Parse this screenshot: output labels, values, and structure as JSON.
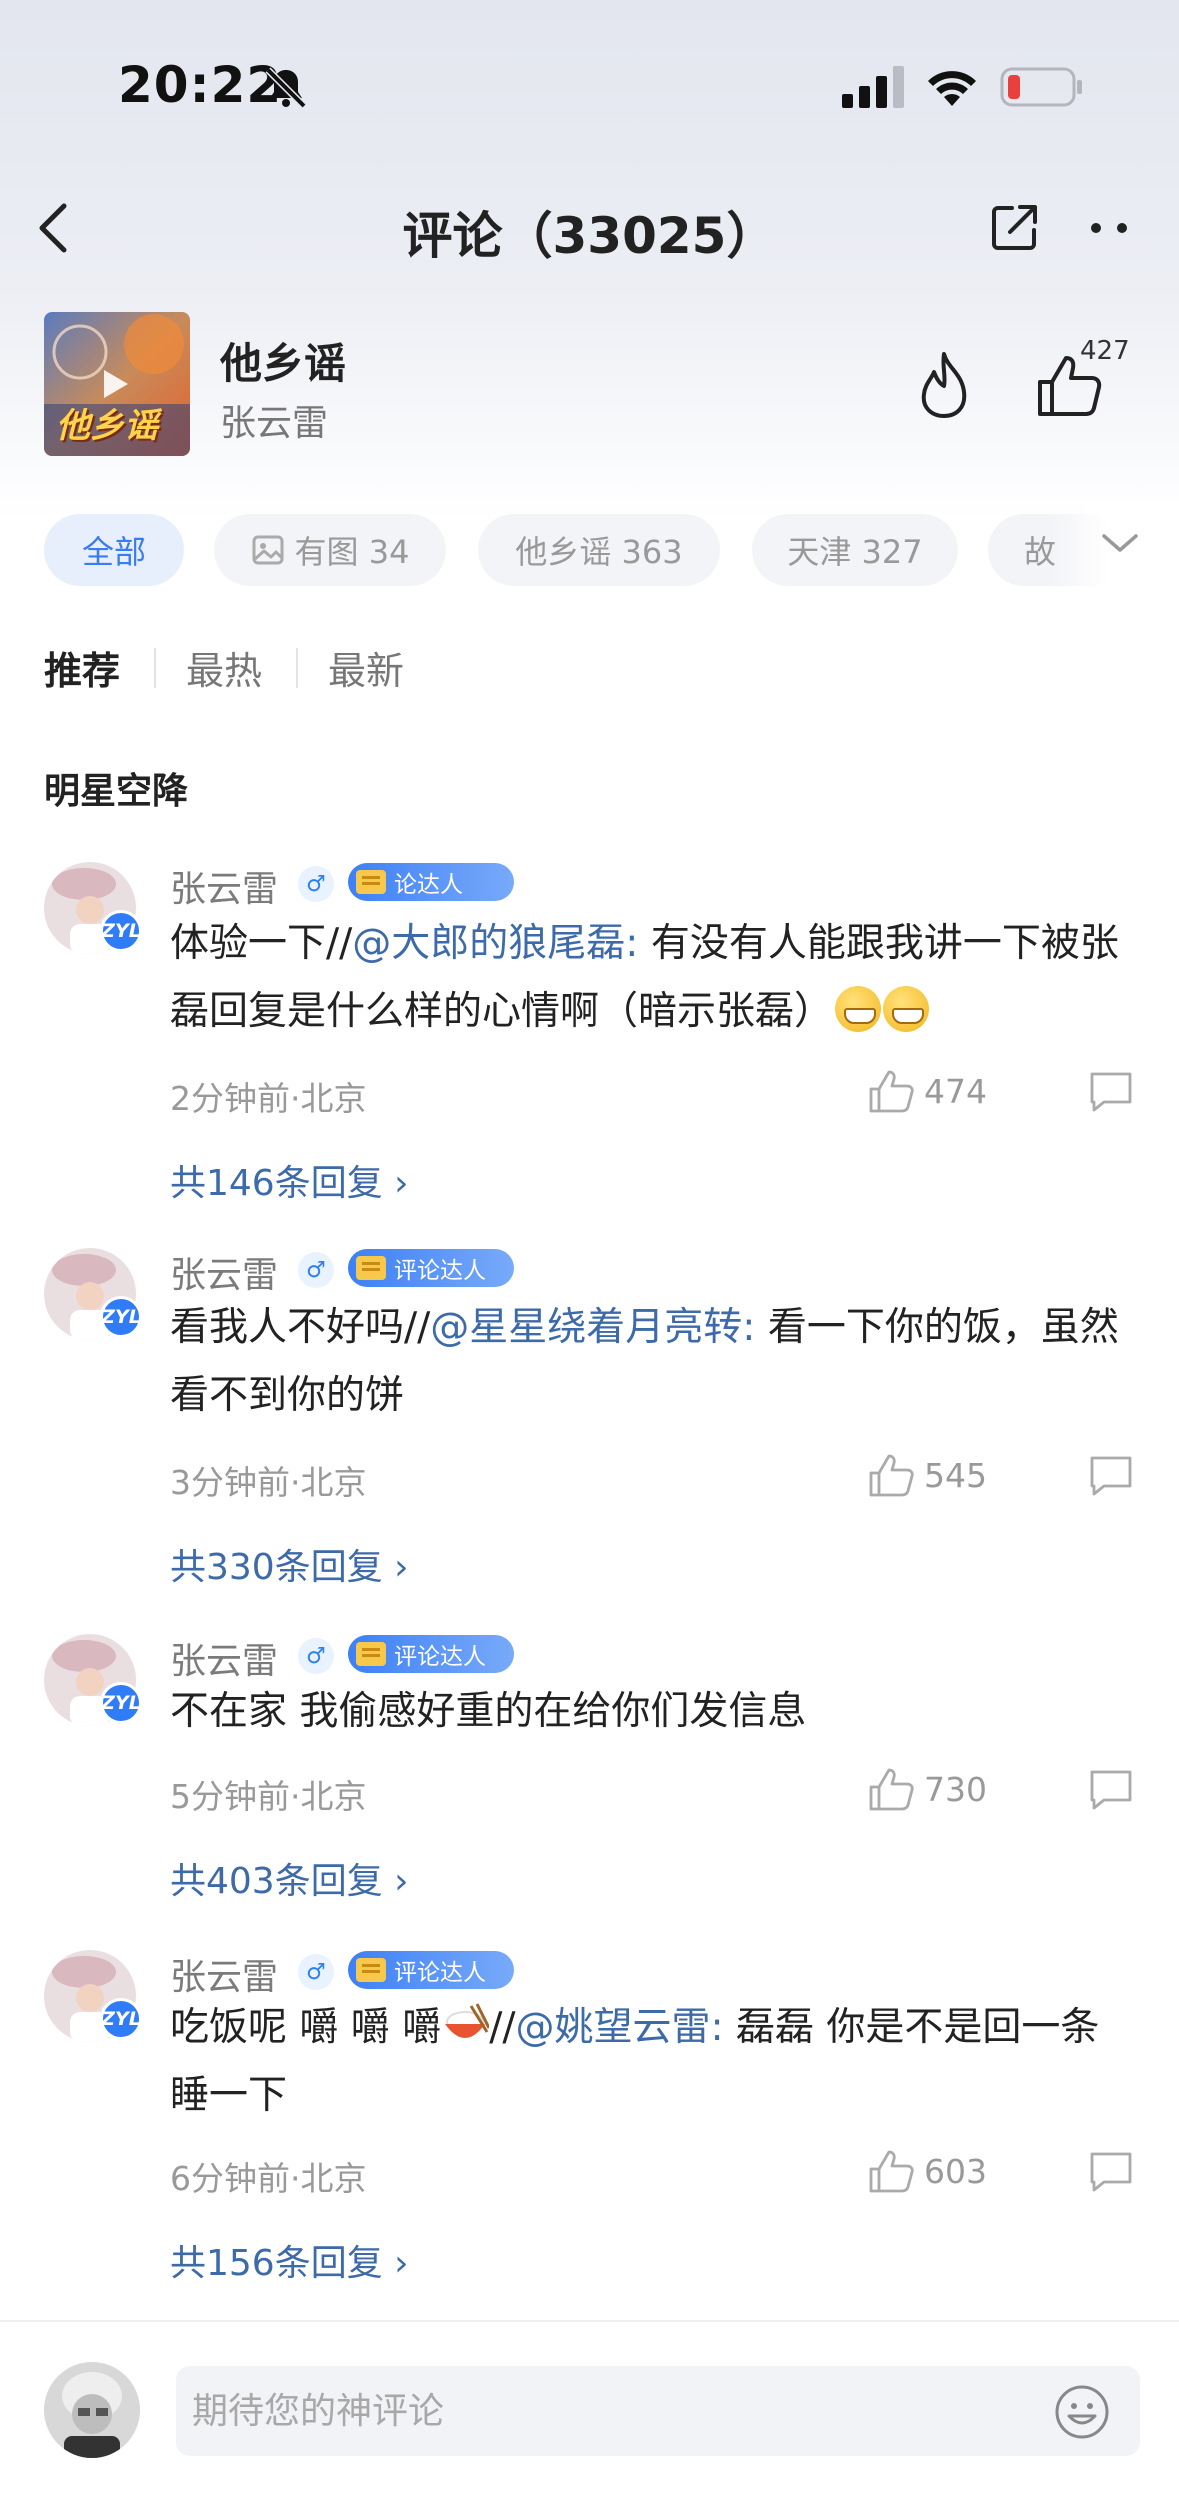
{
  "status_bar": {
    "time": "20:22"
  },
  "nav": {
    "title": "评论（33025）"
  },
  "song": {
    "title": "他乡谣",
    "artist": "张云雷",
    "cover_text": "他乡谣",
    "like_count": "427"
  },
  "chips": [
    {
      "label": "全部"
    },
    {
      "label": "有图 34"
    },
    {
      "label": "他乡谣 363"
    },
    {
      "label": "天津 327"
    },
    {
      "label": "故"
    }
  ],
  "sort_tabs": [
    {
      "label": "推荐"
    },
    {
      "label": "最热"
    },
    {
      "label": "最新"
    }
  ],
  "section_title": "明星空降",
  "comments": [
    {
      "name": "张云雷",
      "badge": "论达人",
      "avatar_badge": "ZYL",
      "text_before": "体验一下//",
      "mention": "@大郎的狼尾磊:",
      "text_after": " 有没有人能跟我讲一下被张磊回复是什么样的心情啊（暗示张磊）",
      "meta": "2分钟前·北京",
      "likes": "474",
      "replies": "共146条回复 ›"
    },
    {
      "name": "张云雷",
      "badge": "评论达人",
      "avatar_badge": "ZYL",
      "text_before": "看我人不好吗//",
      "mention": "@星星绕着月亮转:",
      "text_after": " 看一下你的饭，虽然看不到你的饼",
      "meta": "3分钟前·北京",
      "likes": "545",
      "replies": "共330条回复 ›"
    },
    {
      "name": "张云雷",
      "badge": "评论达人",
      "avatar_badge": "ZYL",
      "text_before": "不在家 我偷感好重的在给你们发信息",
      "mention": "",
      "text_after": "",
      "meta": "5分钟前·北京",
      "likes": "730",
      "replies": "共403条回复 ›"
    },
    {
      "name": "张云雷",
      "badge": "评论达人",
      "avatar_badge": "ZYL",
      "text_before": "吃饭呢 嚼 嚼 嚼",
      "mention_prefix": "//",
      "mention": "@姚望云雷:",
      "text_after": " 磊磊  你是不是回一条睡一下",
      "meta": "6分钟前·北京",
      "likes": "603",
      "replies": "共156条回复 ›"
    }
  ],
  "input": {
    "placeholder": "期待您的神评论"
  },
  "colors": {
    "accent": "#3b7bf2",
    "mention": "#3d6aa8",
    "badge": "#3d80f6"
  }
}
